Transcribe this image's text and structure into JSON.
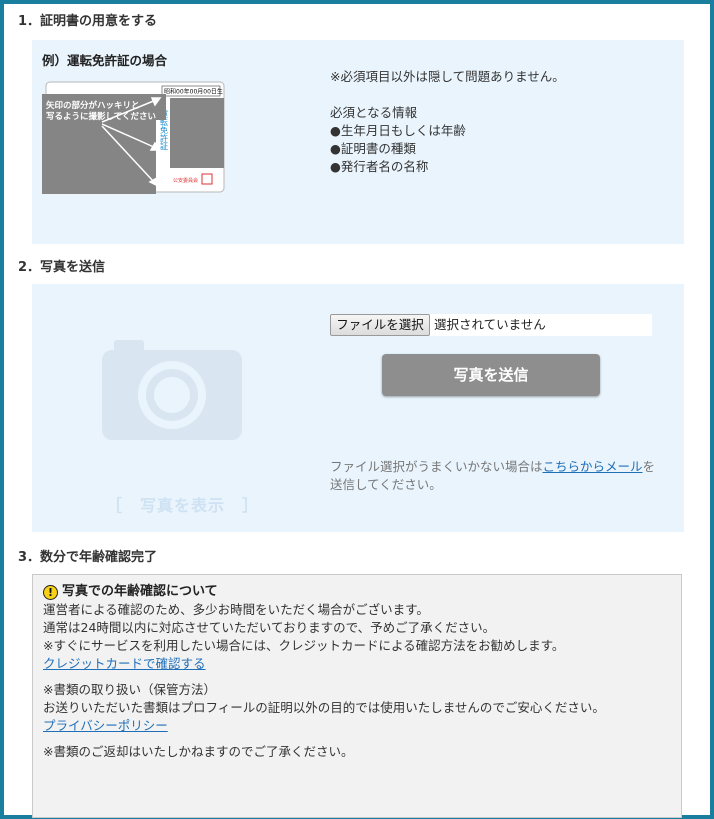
{
  "step1": {
    "title": "1．証明書の用意をする",
    "example_title": "例）運転免許証の場合",
    "license_overlay": [
      "矢印の部分がハッキリと",
      "写るように撮影してください"
    ],
    "license_date": "昭和00年00月00日生",
    "license_vertical": "運転免許証",
    "note": "※必須項目以外は隠して問題ありません。",
    "required_title": "必須となる情報",
    "required_items": [
      "●生年月日もしくは年齢",
      "●証明書の種類",
      "●発行者名の名称"
    ]
  },
  "step2": {
    "title": "2．写真を送信",
    "show_photo": "［　写真を表示　］",
    "file_button": "ファイルを選択",
    "file_status": "選択されていません",
    "send_button": "写真を送信",
    "help_text_before": "ファイル選択がうまくいかない場合は",
    "help_link": "こちらからメール",
    "help_text_after": "を送信してください。"
  },
  "step3": {
    "title": "3．数分で年齢確認完了",
    "box_title": "写真での年齢確認について",
    "line1": "運営者による確認のため、多少お時間をいただく場合がございます。",
    "line2": "通常は24時間以内に対応させていただいておりますので、予めご了承ください。",
    "line3": "※すぐにサービスを利用したい場合には、クレジットカードによる確認方法をお勧めします。",
    "credit_link": "クレジットカードで確認する",
    "handling_title": "※書類の取り扱い（保管方法）",
    "handling_text": "お送りいただいた書類はプロフィールの証明以外の目的では使用いたしませんのでご安心ください。",
    "privacy_link": "プライバシーポリシー",
    "return_note": "※書類のご返却はいたしかねますのでご了承ください。"
  },
  "colors": {
    "frame": "#1a7f9f",
    "panel": "#e9f4fd",
    "send_button": "#8e8e8e",
    "link": "#1f6fb8"
  }
}
